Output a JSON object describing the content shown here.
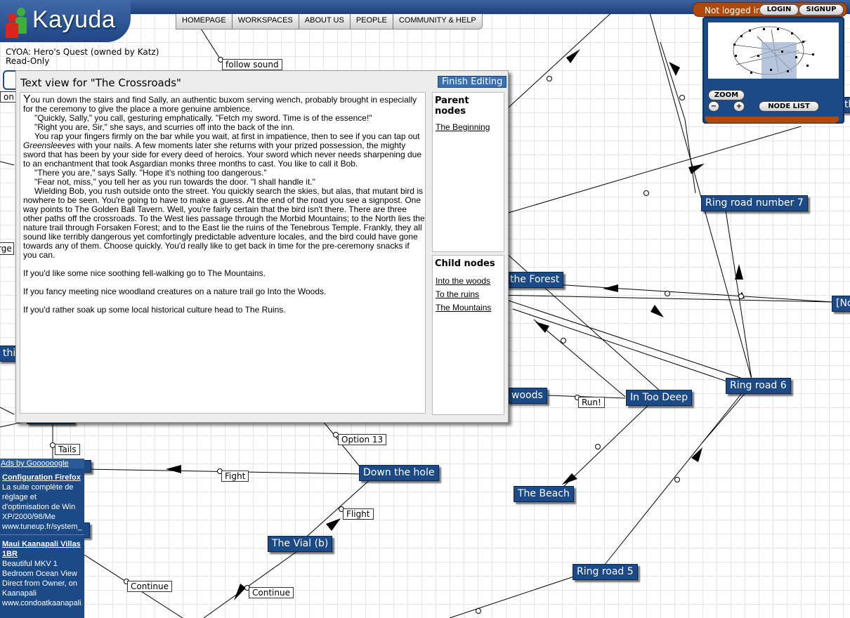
{
  "app": {
    "logo_text": "Kayuda"
  },
  "nav": {
    "items": [
      "HOMEPAGE",
      "WORKSPACES",
      "ABOUT US",
      "PEOPLE",
      "COMMUNITY & HELP"
    ]
  },
  "account": {
    "status": "Not logged in",
    "login": "LOGIN",
    "signup": "SIGNUP"
  },
  "minimap": {
    "zoom": "ZOOM",
    "zoom_out": "−",
    "zoom_in": "+",
    "node_list": "NODE LIST"
  },
  "project": {
    "title": "CYOA: Hero's Quest (owned by Katz)",
    "mode": "Read-Only"
  },
  "graph": {
    "nodes": [
      "Ring road number 7",
      "the Forest",
      "[No",
      "woods",
      "In Too Deep",
      "Ring road 6",
      "Down the hole",
      "The Beach",
      "The Vial (b)",
      "Ring road 5",
      "this",
      "rge",
      "th"
    ],
    "edge_labels": [
      "follow sound",
      "Run!",
      "Option 13",
      "Tails",
      "Fight",
      "Flight",
      "Continue",
      "Continue",
      "on"
    ]
  },
  "text_view": {
    "title": "Text view for \"The Crossroads\"",
    "finish_button": "Finish Editing",
    "paragraphs": [
      "You run down the stairs and find Sally, an authentic buxom serving wench, probably brought in especially for the ceremony to give the place a more genuine ambience.",
      "\"Quickly, Sally,\" you call, gesturing emphatically. \"Fetch my sword. Time is of the essence!\"",
      "\"Right you are, Sir,\" she says, and scurries off into the back of the inn.",
      "You rap your fingers firmly on the bar while you wait, at first in impatience, then to see if you can tap out",
      "Greensleeves",
      "with your nails. A few moments later she returns with your prized possession, the mighty sword that has been by your side for every deed of heroics. Your sword which never needs sharpening due to an enchantment that took Asgardian monks three months to cast. You like to call it Bob.",
      "\"There you are,\" says Sally. \"Hope it's nothing too dangerous.\"",
      "\"Fear not, miss,\" you tell her as you run towards the door. \"I shall handle it.\"",
      "Wielding Bob, you rush outside onto the street. You quickly search the skies, but alas, that mutant bird is nowhere to be seen. You're going to have to make a guess. At the end of the road you see a signpost. One way points to The Golden Ball Tavern. Well, you're fairly certain that the bird isn't there. There are three other paths off the crossroads. To the West lies passage through the Morbid Mountains; to the North lies the nature trail through Forsaken Forest; and to the East lie the ruins of the Tenebrous Temple. Frankly, they all sound like terribly dangerous yet comfortingly predictable adventure locales, and the bird could have gone towards any of them. Choose quickly. You'd really like to get back in time for the pre-ceremony snacks if you can.",
      "If you'd like some nice soothing fell-walking go to The Mountains.",
      "If you fancy meeting nice woodland creatures on a nature trail go Into the Woods.",
      "If you'd rather soak up some local historical culture head to The Ruins."
    ],
    "parent_title": "Parent nodes",
    "parents": [
      "The Beginning"
    ],
    "child_title": "Child nodes",
    "children": [
      "Into the woods",
      "To the ruins",
      "The Mountains"
    ]
  },
  "ads": {
    "header": "Ads by Goooooogle",
    "items": [
      {
        "title": "Configuration Firefox",
        "body": "La suite complète de réglage et d'optimisation de Win XP/2000/98/Me",
        "url": "www.tuneup.fr/system_co"
      },
      {
        "title": "Maui Kaanapali Villas 1BR",
        "body": "Beautiful MKV 1 Bedroom Ocean View Direct from Owner, on Kaanapali",
        "url": "www.condoatkaanapali.c"
      }
    ]
  },
  "colors": {
    "node": "#1c4a86",
    "accent": "#b04a0c",
    "edge": "#000000"
  }
}
